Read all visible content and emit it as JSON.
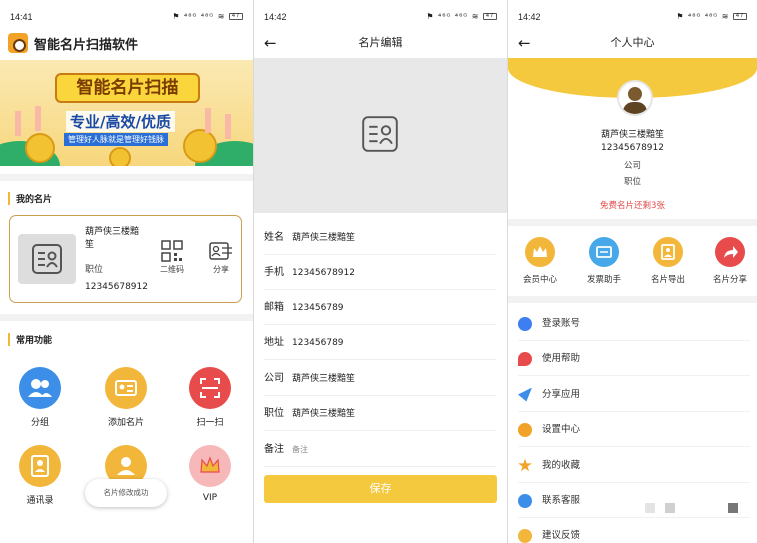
{
  "panel1": {
    "status": {
      "time": "14:41",
      "icons": "⚑ ⁴⁶ᴳ ⁴⁶ᴳ ≋",
      "battery": "47"
    },
    "app_title": "智能名片扫描软件",
    "banner": {
      "title": "智能名片扫描",
      "subtitle": "专业/高效/优质",
      "tagline": "管理好人脉就是管理好钱脉"
    },
    "my_cards_title": "我的名片",
    "card": {
      "name": "葫芦侠三楼黯笙",
      "position": "职位",
      "phone": "12345678912",
      "qr_label": "二维码",
      "share_label": "分享"
    },
    "functions_title": "常用功能",
    "functions": [
      {
        "label": "分组",
        "color": "#3d8ee8",
        "icon": "group-icon"
      },
      {
        "label": "添加名片",
        "color": "#f2b63b",
        "icon": "add-card-icon"
      },
      {
        "label": "扫一扫",
        "color": "#e84b4b",
        "icon": "scan-icon"
      },
      {
        "label": "通讯录",
        "color": "#f2b63b",
        "icon": "contacts-icon"
      },
      {
        "label": "",
        "color": "#f2b63b",
        "icon": "person-icon"
      },
      {
        "label": "VIP",
        "color": "#f6b8b8",
        "icon": "crown-icon"
      }
    ],
    "toast": "名片修改成功"
  },
  "panel2": {
    "status": {
      "time": "14:42",
      "icons": "⚑ ⁴⁶ᴳ ⁴⁶ᴳ ≋",
      "battery": "47"
    },
    "title": "名片编辑",
    "fields": [
      {
        "label": "姓名",
        "value": "葫芦侠三楼黯笙"
      },
      {
        "label": "手机",
        "value": "12345678912"
      },
      {
        "label": "邮箱",
        "value": "123456789"
      },
      {
        "label": "地址",
        "value": "123456789"
      },
      {
        "label": "公司",
        "value": "葫芦侠三楼黯笙"
      },
      {
        "label": "职位",
        "value": "葫芦侠三楼黯笙"
      },
      {
        "label": "备注",
        "placeholder": "备注"
      }
    ],
    "save_label": "保存"
  },
  "panel3": {
    "status": {
      "time": "14:42",
      "icons": "⚑ ⁴⁶ᴳ ⁴⁶ᴳ ≋",
      "battery": "47"
    },
    "title": "个人中心",
    "name": "葫芦侠三楼黯笙",
    "phone": "12345678912",
    "company": "公司",
    "position": "职位",
    "free_notice": "免费名片还剩3张",
    "quick": [
      {
        "label": "会员中心",
        "color": "#f2b63b",
        "icon": "crown-icon"
      },
      {
        "label": "发票助手",
        "color": "#46a8e8",
        "icon": "ticket-icon"
      },
      {
        "label": "名片导出",
        "color": "#f2b63b",
        "icon": "export-icon"
      },
      {
        "label": "名片分享",
        "color": "#e84b4b",
        "icon": "share-icon"
      }
    ],
    "menu": [
      {
        "label": "登录账号",
        "color": "#3d7ff0",
        "icon": "login-icon"
      },
      {
        "label": "使用帮助",
        "color": "#e84b4b",
        "icon": "help-icon"
      },
      {
        "label": "分享应用",
        "color": "#3d8ee8",
        "icon": "share-app-icon"
      },
      {
        "label": "设置中心",
        "color": "#f2a227",
        "icon": "settings-icon"
      },
      {
        "label": "我的收藏",
        "color": "#f2a227",
        "icon": "star-icon"
      },
      {
        "label": "联系客服",
        "color": "#3d8ee8",
        "icon": "customer-service-icon"
      },
      {
        "label": "建议反馈",
        "color": "#f2b63b",
        "icon": "feedback-icon"
      }
    ]
  }
}
